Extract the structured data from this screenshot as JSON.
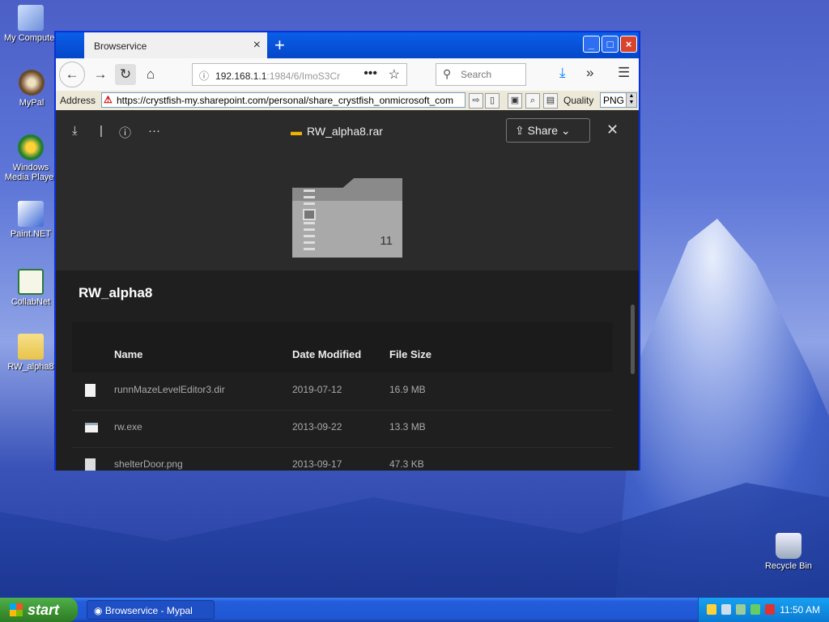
{
  "desktop": {
    "icons": [
      {
        "label": "My Computer",
        "icon": "computer-icon"
      },
      {
        "label": "MyPal",
        "icon": "mypal-icon"
      },
      {
        "label": "Windows Media Player",
        "icon": "media-player-icon"
      },
      {
        "label": "Paint.NET",
        "icon": "paint-icon"
      },
      {
        "label": "CollabNet",
        "icon": "collabnet-icon"
      },
      {
        "label": "RW_alpha8",
        "icon": "archive-icon"
      },
      {
        "label": "Recycle Bin",
        "icon": "recycle-bin-icon"
      }
    ]
  },
  "browser": {
    "tab_title": "Browservice",
    "tab_close": "×",
    "new_tab": "+",
    "url_host": "192.168.1.1",
    "url_rest": ":1984/6/ImoS3Cr",
    "search_placeholder": "Search",
    "address_label": "Address",
    "address_value": "https://crystfish-my.sharepoint.com/personal/share_crystfish_onmicrosoft_com",
    "quality_label": "Quality",
    "format_value": "PNG"
  },
  "viewer": {
    "filename": "RW_alpha8.rar",
    "share_label": "Share",
    "folder_count": "11",
    "folder_title": "RW_alpha8",
    "columns": [
      "Name",
      "Date Modified",
      "File Size"
    ],
    "rows": [
      {
        "name": "runnMazeLevelEditor3.dir",
        "date": "2019-07-12",
        "size": "16.9 MB",
        "icon": "file-icon"
      },
      {
        "name": "rw.exe",
        "date": "2013-09-22",
        "size": "13.3 MB",
        "icon": "exe-icon"
      },
      {
        "name": "shelterDoor.png",
        "date": "2013-09-17",
        "size": "47.3 KB",
        "icon": "image-icon"
      }
    ],
    "help": "?"
  },
  "taskbar": {
    "start_label": "start",
    "task_label": "Browservice - Mypal",
    "clock": "11:50 AM"
  }
}
